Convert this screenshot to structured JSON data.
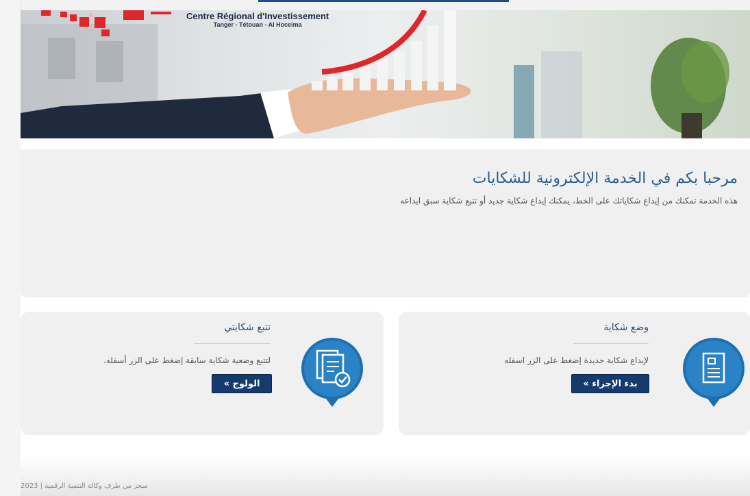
{
  "header": {
    "brand_name": "Centre Régional d'Investissement",
    "brand_sub": "Tanger - Tétouan - Al Hoceima"
  },
  "welcome": {
    "title": "مرحبا بكم في الخدمة الإلكترونية للشكايات",
    "description": "هذه الخدمة تمكنك من إيداع شكاياتك على الخط، يمكنك إيداع شكاية جديد أو تتبع شكاية سبق ايداعه"
  },
  "cards": {
    "track": {
      "title": "تتبع شكايتي",
      "description": "لتتبع وضعية شكاية سابقة إضغط على الزر أسفله.",
      "button": "الولوج »",
      "icon": "document-check-icon"
    },
    "submit": {
      "title": "وضع شكاية",
      "description": "لإيداع شكاية جديدة إضغط على الزر اسفله",
      "button": "بدء الإجراء »",
      "icon": "document-icon"
    }
  },
  "footer": {
    "text": "منجز من طرف وكالة التنمية الرقمية | 2023"
  },
  "colors": {
    "primary": "#163a6b",
    "heading": "#2a5d8f",
    "brand_red": "#e0262b",
    "icon_blue": "#1f6fb0"
  }
}
